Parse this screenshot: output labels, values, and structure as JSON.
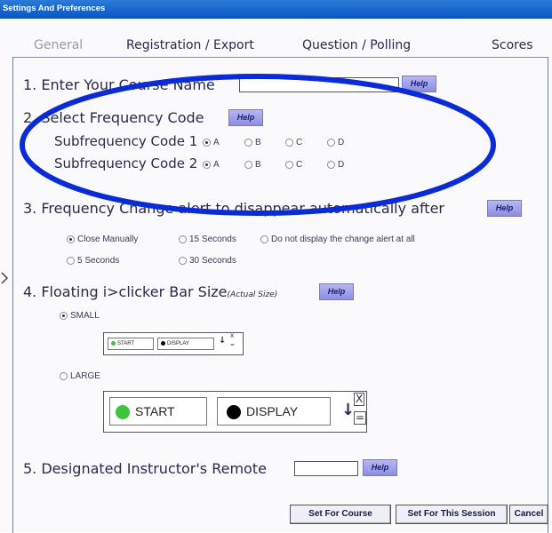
{
  "window": {
    "title": "Settings And Preferences"
  },
  "tabs": [
    {
      "label": "General",
      "active": true
    },
    {
      "label": "Registration / Export",
      "active": false
    },
    {
      "label": "Question / Polling",
      "active": false
    },
    {
      "label": "Scores",
      "active": false
    }
  ],
  "help_label": "Help",
  "course_name": {
    "label": "1. Enter Your Course Name",
    "value": ""
  },
  "frequency": {
    "label": "2. Select Frequency Code",
    "subcodes": [
      {
        "label": "Subfrequency Code 1",
        "options": [
          "A",
          "B",
          "C",
          "D"
        ],
        "selected": "A"
      },
      {
        "label": "Subfrequency Code 2",
        "options": [
          "A",
          "B",
          "C",
          "D"
        ],
        "selected": "A"
      }
    ]
  },
  "alert": {
    "label": "3. Frequency Change alert to disappear automatically after",
    "options": [
      "Close Manually",
      "15 Seconds",
      "Do not display the change alert at all",
      "5 Seconds",
      "30 Seconds"
    ],
    "selected": "Close Manually"
  },
  "bar_size": {
    "label": "4. Floating i>clicker Bar Size",
    "note": "(Actual Size)",
    "small_label": "SMALL",
    "large_label": "LARGE",
    "selected": "SMALL",
    "start_label": "START",
    "display_label": "DISPLAY",
    "arrow_glyph": "↓",
    "close_glyph": "X",
    "equals_glyph": "=",
    "start_color": "#3cc43c",
    "display_color": "#000000"
  },
  "remote": {
    "label": "5. Designated Instructor's Remote",
    "value": ""
  },
  "buttons": {
    "set_course": "Set For Course",
    "set_session": "Set For This Session",
    "cancel": "Cancel"
  },
  "annotation": {
    "ellipse_color": "#0a2bd6"
  }
}
